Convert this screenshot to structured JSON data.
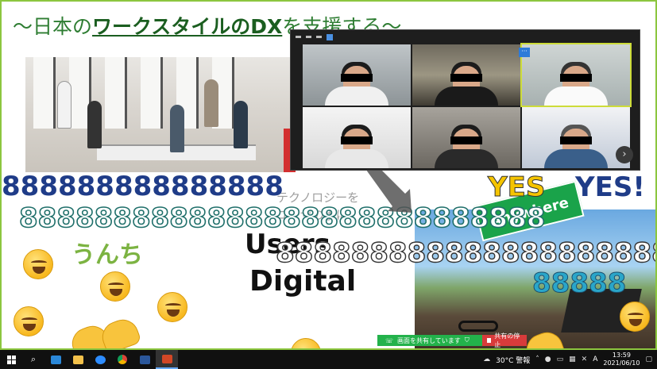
{
  "slide": {
    "title_prefix": "～日本の",
    "title_bold": "ワークスタイルのDX",
    "title_mid": "を",
    "title_suffix": "支援する～",
    "eights_line1": "888888888888888",
    "eights_line2": "8888888888888888888888888888",
    "eights_line3": "888888888888888888888",
    "eights_line4": "88888",
    "yes1": "YES",
    "yes2": "YES!",
    "unchi": "うんち",
    "users": "Users",
    "digital": "Digital",
    "ghost1": "テクノロジーを",
    "ghost2": "ユーザの手に",
    "sign_text": "Anywhere"
  },
  "zoom": {
    "next_icon": "chevron-right-icon",
    "more_label": "···"
  },
  "share_bar": {
    "sharing_label": "画面を共有しています",
    "stop_label": "共有の停止"
  },
  "taskbar": {
    "weather": "30°C 警報",
    "ime": "A",
    "time": "13:59",
    "date": "2021/06/10"
  }
}
